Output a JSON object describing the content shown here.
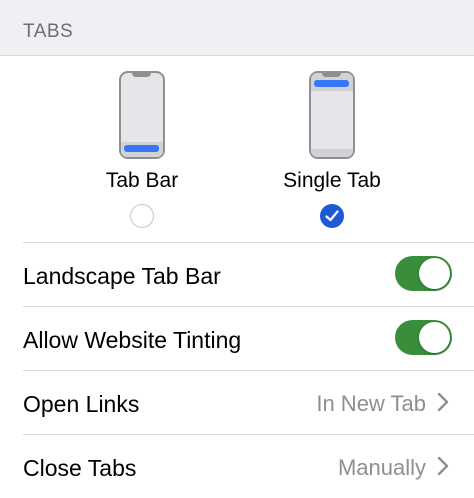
{
  "section": {
    "title": "TABS"
  },
  "layout_options": [
    {
      "label": "Tab Bar",
      "selected": false
    },
    {
      "label": "Single Tab",
      "selected": true
    }
  ],
  "rows": {
    "landscape_tab_bar": {
      "label": "Landscape Tab Bar",
      "on": true
    },
    "allow_tinting": {
      "label": "Allow Website Tinting",
      "on": true
    },
    "open_links": {
      "label": "Open Links",
      "value": "In New Tab"
    },
    "close_tabs": {
      "label": "Close Tabs",
      "value": "Manually"
    }
  },
  "colors": {
    "toggle_on": "#3a8e3b",
    "accent": "#1f5ad6",
    "bar": "#3478f6"
  }
}
